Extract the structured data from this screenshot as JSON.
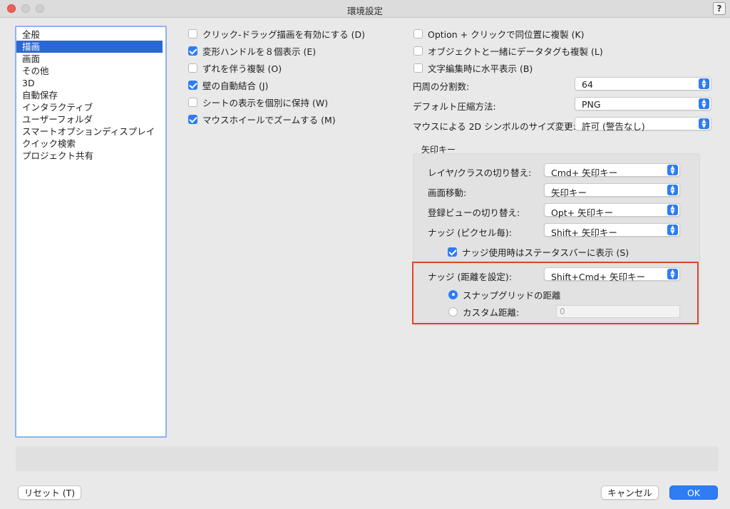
{
  "window": {
    "title": "環境設定",
    "help_label": "?"
  },
  "sidebar": {
    "items": [
      {
        "label": "全般"
      },
      {
        "label": "描画",
        "selected": true
      },
      {
        "label": "画面"
      },
      {
        "label": "その他"
      },
      {
        "label": "3D"
      },
      {
        "label": "自動保存"
      },
      {
        "label": "インタラクティブ"
      },
      {
        "label": "ユーザーフォルダ"
      },
      {
        "label": "スマートオプションディスプレイ"
      },
      {
        "label": "クイック検索"
      },
      {
        "label": "プロジェクト共有"
      }
    ]
  },
  "left_options": [
    {
      "label": "クリック-ドラッグ描画を有効にする (D)",
      "checked": false
    },
    {
      "label": "変形ハンドルを８個表示 (E)",
      "checked": true
    },
    {
      "label": "ずれを伴う複製 (O)",
      "checked": false
    },
    {
      "label": "壁の自動結合 (J)",
      "checked": true
    },
    {
      "label": "シートの表示を個別に保持 (W)",
      "checked": false
    },
    {
      "label": "マウスホイールでズームする (M)",
      "checked": true
    }
  ],
  "right_options": [
    {
      "label": "Option + クリックで同位置に複製 (K)",
      "checked": false
    },
    {
      "label": "オブジェクトと一緒にデータタグも複製 (L)",
      "checked": false
    },
    {
      "label": "文字編集時に水平表示 (B)",
      "checked": false
    }
  ],
  "selects": {
    "circle_divisions": {
      "label": "円周の分割数:",
      "value": "64"
    },
    "compression": {
      "label": "デフォルト圧縮方法:",
      "value": "PNG"
    },
    "symbol_resize": {
      "label": "マウスによる 2D シンボルのサイズ変更:",
      "value": "許可 (警告なし)"
    }
  },
  "arrow_keys": {
    "group_title": "矢印キー",
    "layer_class": {
      "label": "レイヤ/クラスの切り替え:",
      "value": "Cmd+ 矢印キー"
    },
    "pan": {
      "label": "画面移動:",
      "value": "矢印キー"
    },
    "saved_view": {
      "label": "登録ビューの切り替え:",
      "value": "Opt+ 矢印キー"
    },
    "nudge_pixel": {
      "label": "ナッジ (ピクセル毎):",
      "value": "Shift+ 矢印キー"
    },
    "status_bar_check": {
      "label": "ナッジ使用時はステータスバーに表示 (S)",
      "checked": true
    },
    "nudge_distance": {
      "label": "ナッジ (距離を設定):",
      "value": "Shift+Cmd+ 矢印キー"
    },
    "snap_grid_radio": {
      "label": "スナップグリッドの距離",
      "selected": true
    },
    "custom_radio": {
      "label": "カスタム距離:",
      "selected": false
    },
    "custom_value": "0"
  },
  "buttons": {
    "reset": "リセット (T)",
    "cancel": "キャンセル",
    "ok": "OK"
  },
  "colors": {
    "accent": "#2e7cf6",
    "highlight_box": "#e0432c",
    "sidebar_selection": "#2b67d6"
  }
}
